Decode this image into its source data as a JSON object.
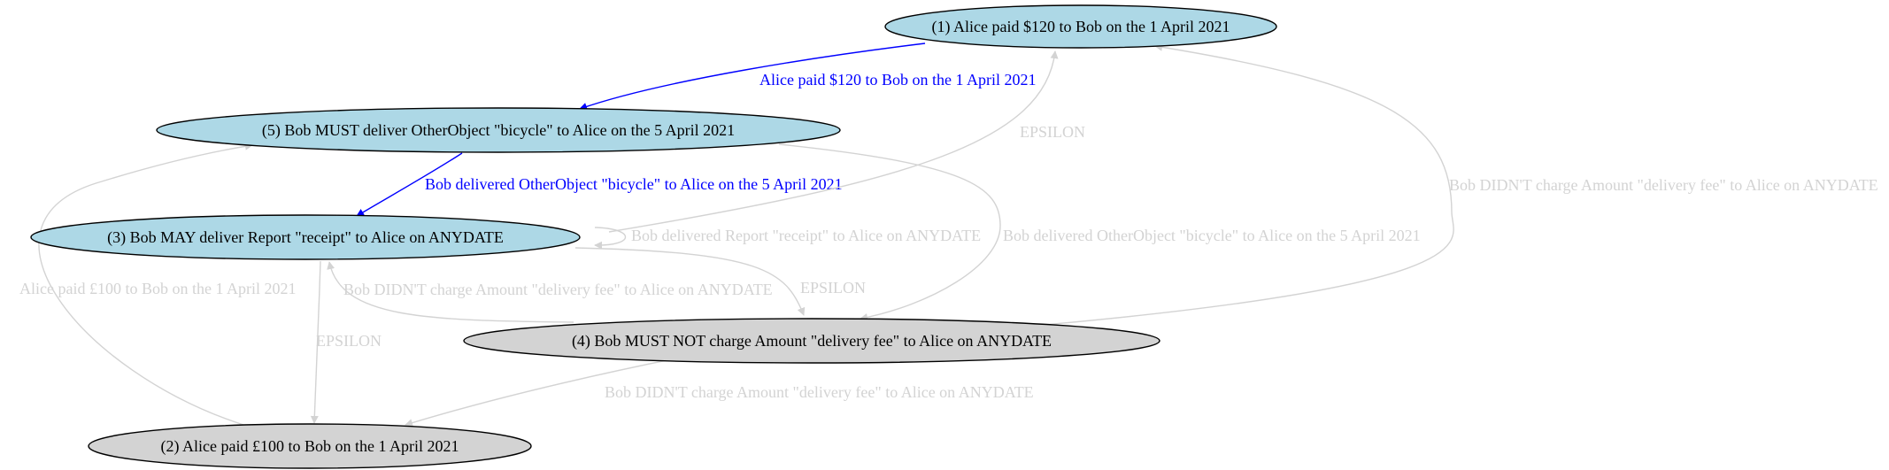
{
  "colors": {
    "active_node_fill": "#add8e6",
    "inactive_node_fill": "#d3d3d3",
    "node_stroke": "#000000",
    "active_edge": "#0000ff",
    "inactive_edge": "#d3d3d3"
  },
  "nodes": {
    "n1": {
      "label": "(1) Alice paid $120 to Bob on the 1 April 2021",
      "state": "active"
    },
    "n2": {
      "label": "(2) Alice paid £100 to Bob on the 1 April 2021",
      "state": "inactive"
    },
    "n3": {
      "label": "(3) Bob MAY deliver Report \"receipt\" to Alice on ANYDATE",
      "state": "active"
    },
    "n4": {
      "label": "(4) Bob MUST NOT charge Amount \"delivery fee\" to Alice on ANYDATE",
      "state": "inactive"
    },
    "n5": {
      "label": "(5) Bob MUST deliver OtherObject \"bicycle\" to Alice on the 5 April 2021",
      "state": "active"
    }
  },
  "edges": {
    "e1_5": {
      "from": "n1",
      "to": "n5",
      "label": "Alice paid $120 to Bob on the 1 April 2021",
      "state": "active"
    },
    "e5_3": {
      "from": "n5",
      "to": "n3",
      "label": "Bob delivered OtherObject \"bicycle\" to Alice on the 5 April 2021",
      "state": "active"
    },
    "e3_1": {
      "from": "n3",
      "to": "n1",
      "label": "EPSILON",
      "state": "inactive"
    },
    "e4_1": {
      "from": "n4",
      "to": "n1",
      "label": "Bob DIDN'T charge Amount \"delivery fee\" to Alice on ANYDATE",
      "state": "inactive"
    },
    "e3_3": {
      "from": "n3",
      "to": "n3",
      "label": "Bob delivered Report \"receipt\" to Alice on ANYDATE",
      "state": "inactive"
    },
    "e5_4": {
      "from": "n5",
      "to": "n4",
      "label": "Bob delivered OtherObject \"bicycle\" to Alice on the 5 April 2021",
      "state": "inactive"
    },
    "e3_4": {
      "from": "n3",
      "to": "n4",
      "label": "EPSILON",
      "state": "inactive"
    },
    "e4_3": {
      "from": "n4",
      "to": "n3",
      "label": "Bob DIDN'T charge Amount \"delivery fee\" to Alice on ANYDATE",
      "state": "inactive"
    },
    "e2_5": {
      "from": "n2",
      "to": "n5",
      "label": "Alice paid £100 to Bob on the 1 April 2021",
      "state": "inactive"
    },
    "e3_2": {
      "from": "n3",
      "to": "n2",
      "label": "EPSILON",
      "state": "inactive"
    },
    "e4_2": {
      "from": "n4",
      "to": "n2",
      "label": "Bob DIDN'T charge Amount \"delivery fee\" to Alice on ANYDATE",
      "state": "inactive"
    }
  }
}
